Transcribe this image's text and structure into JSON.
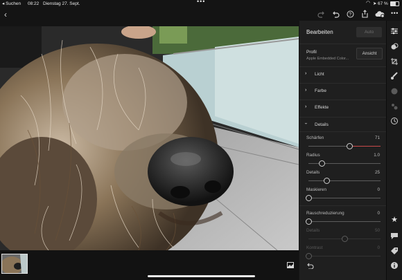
{
  "status_bar": {
    "back_app": "◂ Suchen",
    "time": "08:22",
    "date": "Dienstag 27. Sept.",
    "battery": "67 %"
  },
  "toolbar": {
    "back_icon": "chevron-left-icon",
    "icons": [
      "redo-icon",
      "undo-icon",
      "help-icon",
      "share-icon",
      "cloud-icon",
      "more-icon"
    ]
  },
  "panel": {
    "title": "Bearbeiten",
    "auto_label": "Auto",
    "profile_label": "Profil",
    "profile_value": "Apple Embedded Color...",
    "view_label": "Ansicht",
    "sections": [
      "Licht",
      "Farbe",
      "Effekte",
      "Details"
    ],
    "sliders": [
      {
        "label": "Schärfen",
        "value": "71",
        "level": 0.57,
        "dim": false,
        "accent": true
      },
      {
        "label": "Radius",
        "value": "1.0",
        "level": 0.18,
        "dim": false,
        "accent": false
      },
      {
        "label": "Details",
        "value": "25",
        "level": 0.25,
        "dim": false,
        "accent": false
      },
      {
        "label": "Maskieren",
        "value": "0",
        "level": 0.0,
        "dim": false,
        "accent": false
      },
      {
        "label": "Rauschreduzierung",
        "value": "0",
        "level": 0.0,
        "dim": false,
        "accent": false
      },
      {
        "label": "Details",
        "value": "50",
        "level": 0.5,
        "dim": true,
        "accent": false
      },
      {
        "label": "Kontrast",
        "value": "0",
        "level": 0.0,
        "dim": true,
        "accent": false
      }
    ]
  },
  "rail": {
    "top_icons": [
      "sliders-icon",
      "presets-icon",
      "crop-icon",
      "brush-icon",
      "heal-icon",
      "versions-icon",
      "history-icon"
    ],
    "bottom_icons": [
      "star-icon",
      "comment-icon",
      "tag-icon",
      "info-icon"
    ]
  },
  "colors": {
    "accent": "#c94a4a",
    "panel_bg": "#1f1f1f",
    "app_bg": "#141414"
  }
}
